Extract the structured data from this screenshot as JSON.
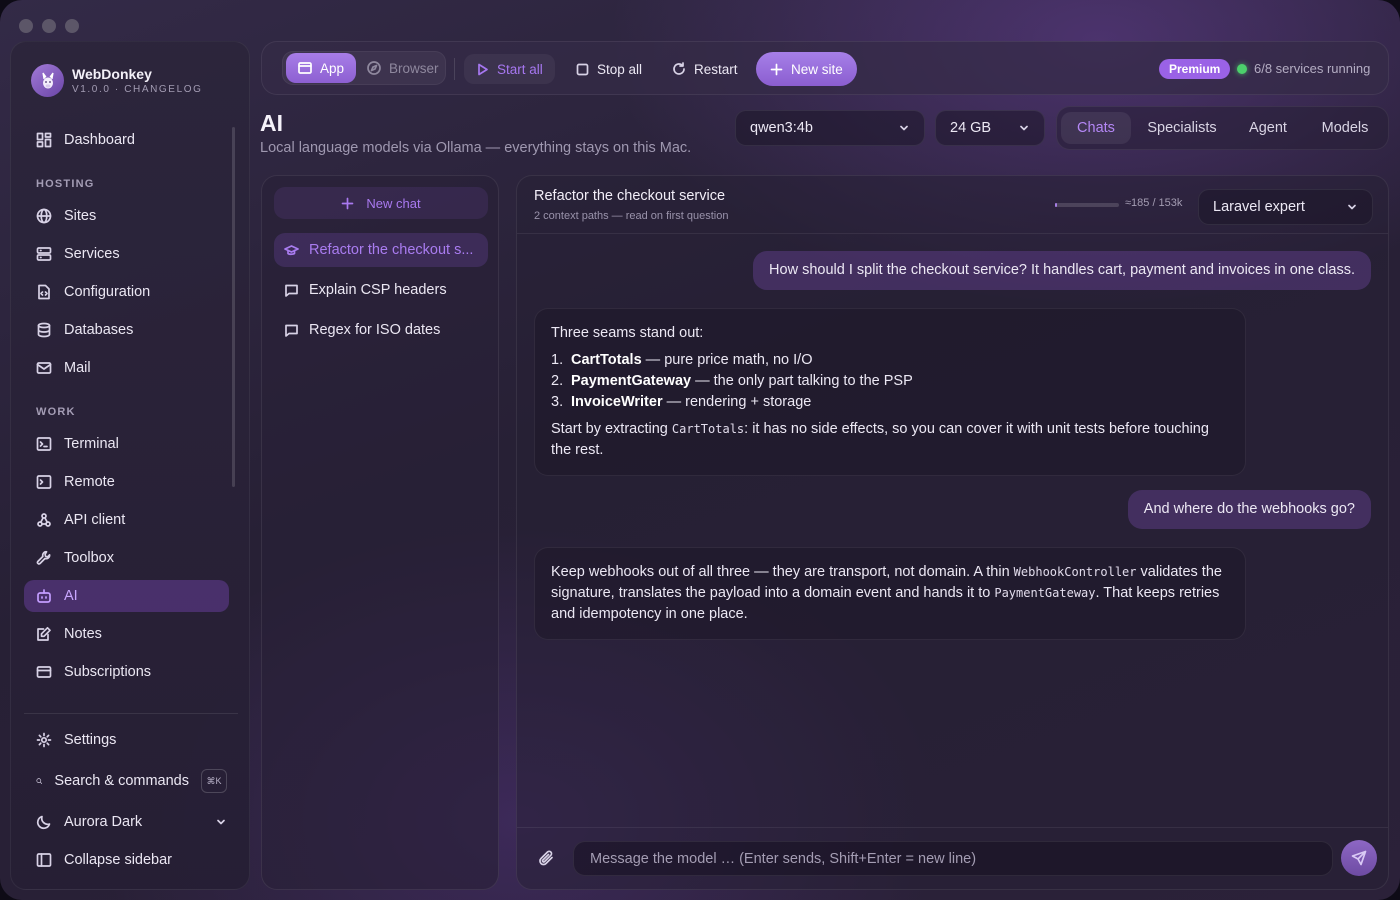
{
  "brand": {
    "name": "WebDonkey",
    "version_line": "V1.0.0 · CHANGELOG"
  },
  "sidebar": {
    "dashboard": "Dashboard",
    "section_hosting": "HOSTING",
    "hosting": [
      {
        "label": "Sites",
        "icon": "globe-icon"
      },
      {
        "label": "Services",
        "icon": "server-icon"
      },
      {
        "label": "Configuration",
        "icon": "file-code-icon"
      },
      {
        "label": "Databases",
        "icon": "database-icon"
      },
      {
        "label": "Mail",
        "icon": "mail-icon"
      }
    ],
    "section_work": "WORK",
    "work": [
      {
        "label": "Terminal",
        "icon": "terminal-icon"
      },
      {
        "label": "Remote",
        "icon": "remote-terminal-icon"
      },
      {
        "label": "API client",
        "icon": "api-icon"
      },
      {
        "label": "Toolbox",
        "icon": "wrench-icon"
      },
      {
        "label": "AI",
        "icon": "bot-icon"
      },
      {
        "label": "Notes",
        "icon": "notes-icon"
      },
      {
        "label": "Subscriptions",
        "icon": "card-icon"
      }
    ],
    "active": "AI",
    "settings": "Settings",
    "search": "Search & commands",
    "search_shortcut": "⌘K",
    "theme": "Aurora Dark",
    "collapse": "Collapse sidebar"
  },
  "toolbar": {
    "app": "App",
    "browser": "Browser",
    "start_all": "Start all",
    "stop_all": "Stop all",
    "restart": "Restart",
    "new_site": "New site",
    "badge": "Premium",
    "services_status": "6/8 services running",
    "accent": "#9a62e6",
    "status_color": "#4cd06c"
  },
  "page": {
    "title": "AI",
    "subtitle": "Local language models via Ollama — everything stays on this Mac."
  },
  "model_select": {
    "value": "qwen3:4b"
  },
  "ram_select": {
    "value": "24 GB"
  },
  "tabs": [
    {
      "label": "Chats",
      "active": true
    },
    {
      "label": "Specialists"
    },
    {
      "label": "Agent"
    },
    {
      "label": "Models"
    }
  ],
  "chats": {
    "new_chat": "New chat",
    "items": [
      {
        "title": "Refactor the checkout s...",
        "active": true
      },
      {
        "title": "Explain CSP headers"
      },
      {
        "title": "Regex for ISO dates"
      }
    ]
  },
  "conversation": {
    "title": "Refactor the checkout service",
    "subtitle": "2 context paths — read on first question",
    "context_used_fraction": 0.0012,
    "context": "≈185 / 153k",
    "specialist": "Laravel expert",
    "messages": {
      "u1": "How should I split the checkout service? It handles cart, payment and invoices in one class.",
      "a1_intro": "Three seams stand out:",
      "a1_list": [
        {
          "n": "1.",
          "name": "CartTotals",
          "desc": " — pure price math, no I/O"
        },
        {
          "n": "2.",
          "name": "PaymentGateway",
          "desc": " — the only part talking to the PSP"
        },
        {
          "n": "3.",
          "name": "InvoiceWriter",
          "desc": " — rendering + storage"
        }
      ],
      "a1_outro_pre": "Start by extracting ",
      "a1_outro_code": "CartTotals",
      "a1_outro_post": ": it has no side effects, so you can cover it with unit tests before touching the rest.",
      "u2": "And where do the webhooks go?",
      "a2_p1": "Keep webhooks out of all three — they are transport, not domain. A thin ",
      "a2_code1": "WebhookController",
      "a2_p2": " validates the signature, translates the payload into a domain event and hands it to ",
      "a2_code2": "PaymentGateway",
      "a2_p3": ". That keeps retries and idempotency in one place."
    }
  },
  "composer": {
    "placeholder": "Message the model … (Enter sends, Shift+Enter = new line)",
    "value": ""
  }
}
